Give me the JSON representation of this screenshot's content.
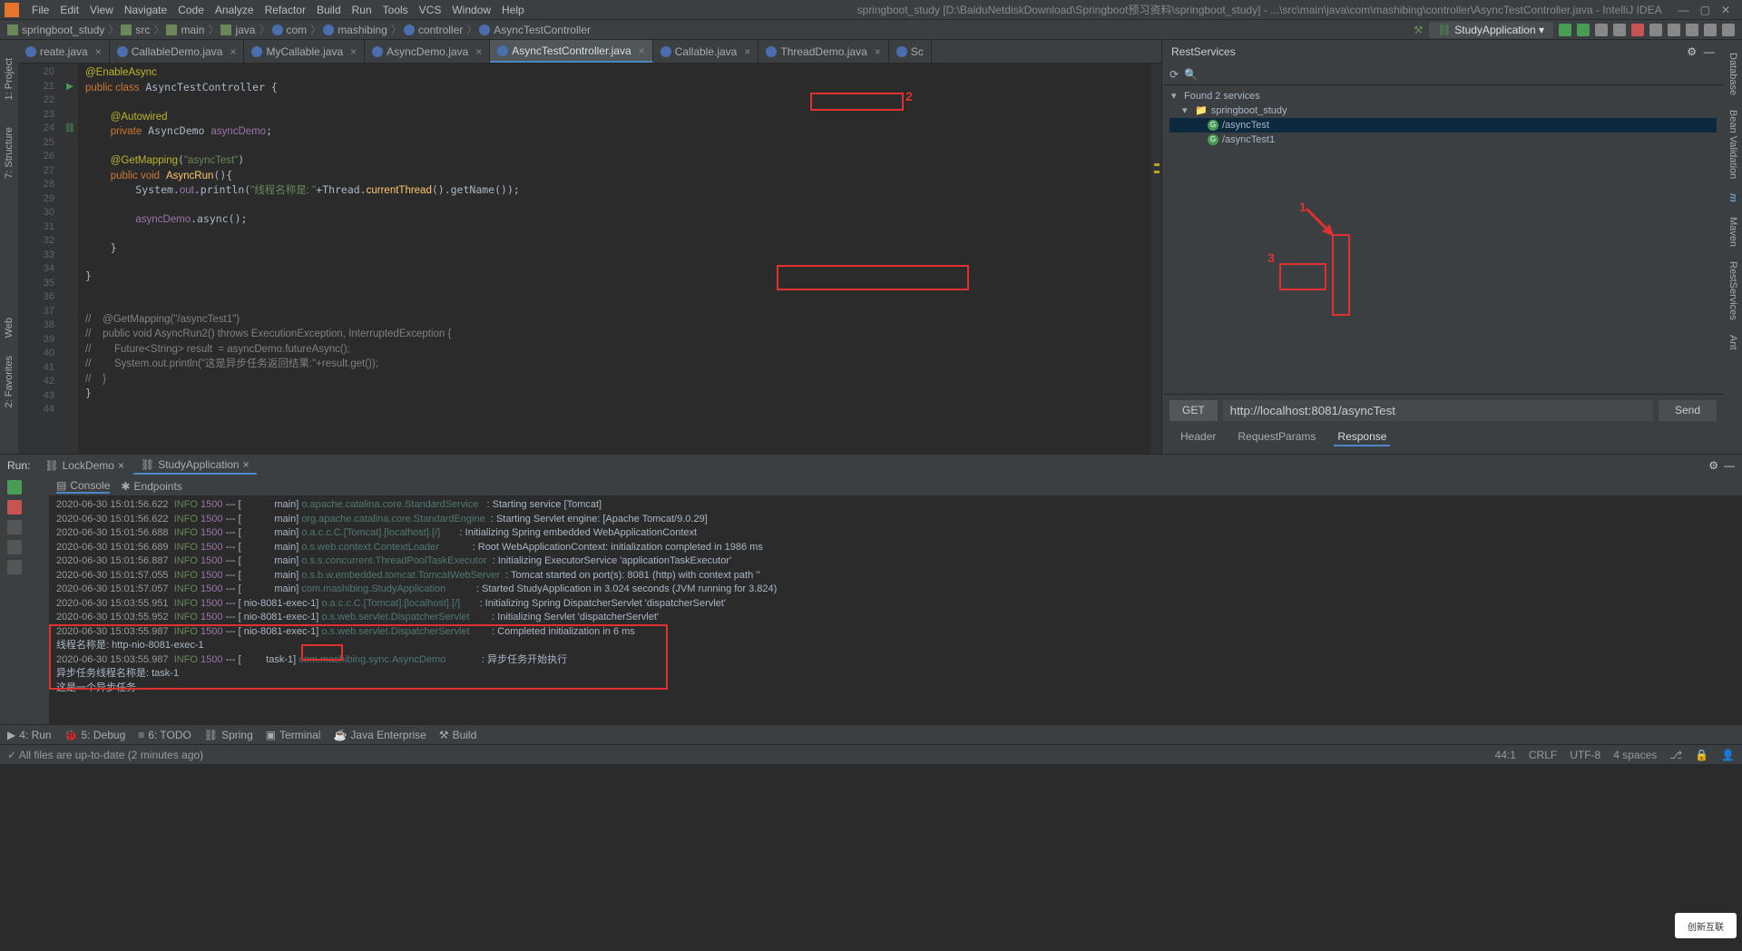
{
  "window": {
    "title": "springboot_study [D:\\BaiduNetdiskDownload\\Springboot预习资料\\springboot_study] - ...\\src\\main\\java\\com\\mashibing\\controller\\AsyncTestController.java - IntelliJ IDEA"
  },
  "menu": [
    "File",
    "Edit",
    "View",
    "Navigate",
    "Code",
    "Analyze",
    "Refactor",
    "Build",
    "Run",
    "Tools",
    "VCS",
    "Window",
    "Help"
  ],
  "breadcrumb": [
    "springboot_study",
    "src",
    "main",
    "java",
    "com",
    "mashibing",
    "controller",
    "AsyncTestController"
  ],
  "run_config": "StudyApplication",
  "tabs": [
    {
      "label": "reate.java",
      "active": false
    },
    {
      "label": "CallableDemo.java",
      "active": false
    },
    {
      "label": "MyCallable.java",
      "active": false
    },
    {
      "label": "AsyncDemo.java",
      "active": false
    },
    {
      "label": "AsyncTestController.java",
      "active": true
    },
    {
      "label": "Callable.java",
      "active": false
    },
    {
      "label": "ThreadDemo.java",
      "active": false
    },
    {
      "label": "Sc",
      "active": false
    }
  ],
  "code_lines": [
    20,
    21,
    22,
    23,
    24,
    25,
    26,
    27,
    28,
    29,
    30,
    31,
    32,
    33,
    34,
    35,
    36,
    37,
    38,
    39,
    40,
    41,
    42,
    43,
    44
  ],
  "rest": {
    "title": "RestServices",
    "found": "Found 2 services",
    "project": "springboot_study",
    "endpoints": [
      "/asyncTest",
      "/asyncTest1"
    ],
    "method": "GET",
    "url": "http://localhost:8081/asyncTest",
    "send": "Send",
    "form_tabs": [
      "Header",
      "RequestParams",
      "Response"
    ]
  },
  "annotations": {
    "a1": "1",
    "a2": "2",
    "a3": "3"
  },
  "right_tools": [
    "Database",
    "Bean Validation",
    "Maven",
    "RestServices",
    "Ant"
  ],
  "left_tools": {
    "project": "1: Project",
    "structure": "7: Structure",
    "web": "Web",
    "favorites": "2: Favorites"
  },
  "run": {
    "title": "Run:",
    "tabs": [
      "LockDemo",
      "StudyApplication"
    ],
    "subtabs": [
      "Console",
      "Endpoints"
    ]
  },
  "console_lines": [
    {
      "ts": "2020-06-30 15:01:56.622",
      "lvl": "INFO",
      "pid": "1500",
      "thr": "main",
      "cls": "o.apache.catalina.core.StandardService",
      "msg": ": Starting service [Tomcat]"
    },
    {
      "ts": "2020-06-30 15:01:56.622",
      "lvl": "INFO",
      "pid": "1500",
      "thr": "main",
      "cls": "org.apache.catalina.core.StandardEngine",
      "msg": ": Starting Servlet engine: [Apache Tomcat/9.0.29]"
    },
    {
      "ts": "2020-06-30 15:01:56.688",
      "lvl": "INFO",
      "pid": "1500",
      "thr": "main",
      "cls": "o.a.c.c.C.[Tomcat].[localhost].[/]",
      "msg": ": Initializing Spring embedded WebApplicationContext"
    },
    {
      "ts": "2020-06-30 15:01:56.689",
      "lvl": "INFO",
      "pid": "1500",
      "thr": "main",
      "cls": "o.s.web.context.ContextLoader",
      "msg": ": Root WebApplicationContext: initialization completed in 1986 ms"
    },
    {
      "ts": "2020-06-30 15:01:56.887",
      "lvl": "INFO",
      "pid": "1500",
      "thr": "main",
      "cls": "o.s.s.concurrent.ThreadPoolTaskExecutor",
      "msg": ": Initializing ExecutorService 'applicationTaskExecutor'"
    },
    {
      "ts": "2020-06-30 15:01:57.055",
      "lvl": "INFO",
      "pid": "1500",
      "thr": "main",
      "cls": "o.s.b.w.embedded.tomcat.TomcatWebServer",
      "msg": ": Tomcat started on port(s): 8081 (http) with context path ''"
    },
    {
      "ts": "2020-06-30 15:01:57.057",
      "lvl": "INFO",
      "pid": "1500",
      "thr": "main",
      "cls": "com.mashibing.StudyApplication",
      "msg": ": Started StudyApplication in 3.024 seconds (JVM running for 3.824)"
    },
    {
      "ts": "2020-06-30 15:03:55.951",
      "lvl": "INFO",
      "pid": "1500",
      "thr": "nio-8081-exec-1",
      "cls": "o.a.c.c.C.[Tomcat].[localhost].[/]",
      "msg": ": Initializing Spring DispatcherServlet 'dispatcherServlet'"
    },
    {
      "ts": "2020-06-30 15:03:55.952",
      "lvl": "INFO",
      "pid": "1500",
      "thr": "nio-8081-exec-1",
      "cls": "o.s.web.servlet.DispatcherServlet",
      "msg": ": Initializing Servlet 'dispatcherServlet'"
    },
    {
      "ts": "2020-06-30 15:03:55.987",
      "lvl": "INFO",
      "pid": "1500",
      "thr": "nio-8081-exec-1",
      "cls": "o.s.web.servlet.DispatcherServlet",
      "msg": ": Completed initialization in 6 ms"
    }
  ],
  "console_extra": {
    "l1": "线程名称是: http-nio-8081-exec-1",
    "l2_ts": "2020-06-30 15:03:55.987",
    "l2_thr": "task-1",
    "l2_cls": "com.mashibing.sync.AsyncDemo",
    "l2_msg": ": 异步任务开始执行",
    "l3": "异步任务线程名称是: task-1",
    "l4": "这是一个异步任务"
  },
  "bottom_tabs": [
    "4: Run",
    "5: Debug",
    "6: TODO",
    "Spring",
    "Terminal",
    "Java Enterprise",
    "Build"
  ],
  "status": {
    "msg": "All files are up-to-date (2 minutes ago)",
    "pos": "44:1",
    "le": "CRLF",
    "enc": "UTF-8",
    "indent": "4 spaces"
  },
  "watermark": "创新互联"
}
